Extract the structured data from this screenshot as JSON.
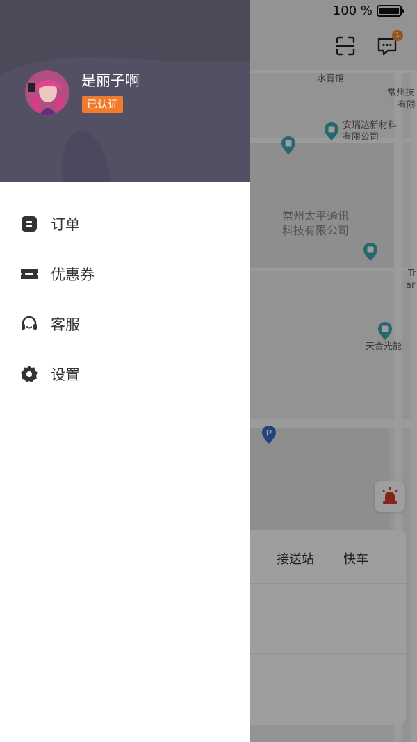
{
  "status_bar": {
    "battery_text": "100 %"
  },
  "map": {
    "labels": [
      "水育馆",
      "常州技",
      "有限",
      "安瑞达新材料",
      "有限公司",
      "常州太平通讯",
      "科技有限公司",
      "Tr",
      "ar",
      "天合光能"
    ],
    "message_badge": "1"
  },
  "bottom_card": {
    "tabs": [
      "接送站",
      "快车"
    ]
  },
  "drawer": {
    "username": "是丽子啊",
    "verified_label": "已认证",
    "menu": [
      {
        "label": "订单",
        "icon": "order-icon"
      },
      {
        "label": "优惠券",
        "icon": "coupon-icon"
      },
      {
        "label": "客服",
        "icon": "headset-icon"
      },
      {
        "label": "设置",
        "icon": "gear-icon"
      }
    ]
  },
  "colors": {
    "header_bg": "#4c4a59",
    "accent": "#f17a2c",
    "text": "#333333"
  }
}
